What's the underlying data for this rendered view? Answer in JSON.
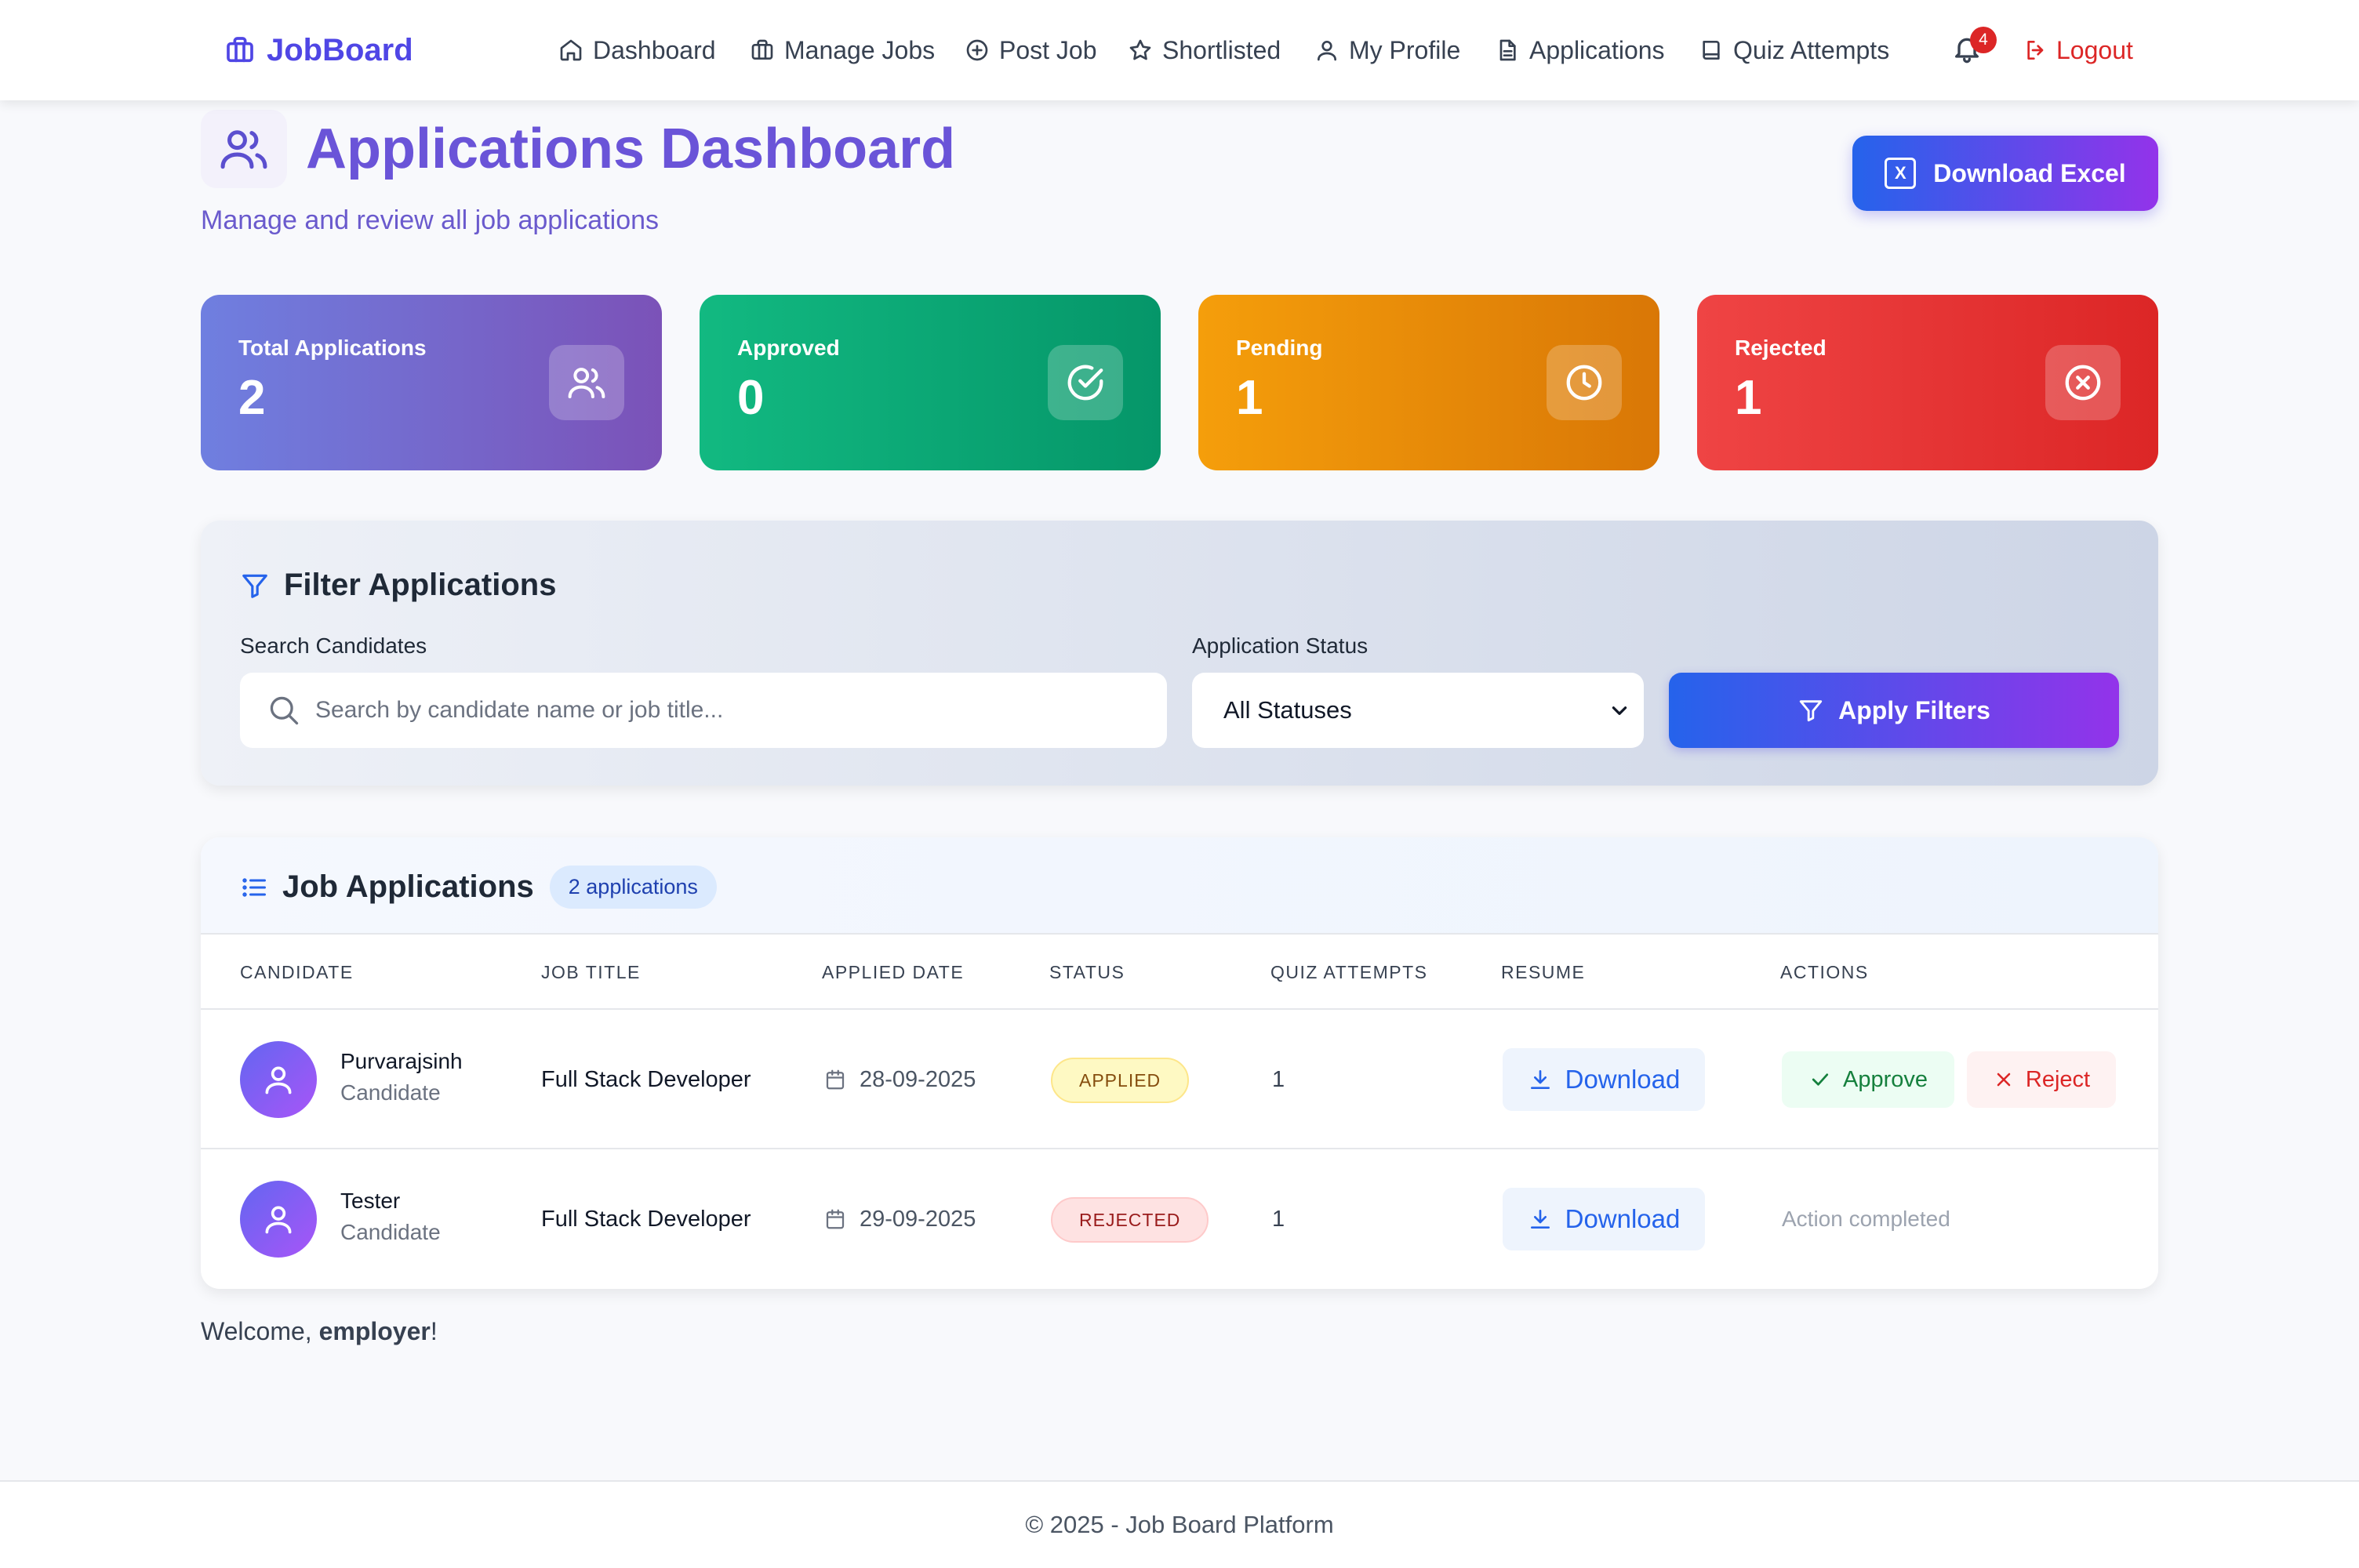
{
  "navbar": {
    "brand": "JobBoard",
    "links": [
      "Dashboard",
      "Manage Jobs",
      "Post Job",
      "Shortlisted",
      "My Profile",
      "Applications",
      "Quiz Attempts"
    ],
    "notification_count": "4",
    "logout": "Logout"
  },
  "header": {
    "title": "Applications Dashboard",
    "subtitle": "Manage and review all job applications",
    "download_excel": "Download Excel",
    "excel_icon_letter": "X"
  },
  "stats": [
    {
      "label": "Total Applications",
      "value": "2",
      "icon": "users-icon",
      "color": "#7b6fd6"
    },
    {
      "label": "Approved",
      "value": "0",
      "icon": "check-circle-icon",
      "color": "#10b981"
    },
    {
      "label": "Pending",
      "value": "1",
      "icon": "clock-icon",
      "color": "#f59e0b"
    },
    {
      "label": "Rejected",
      "value": "1",
      "icon": "x-circle-icon",
      "color": "#ef4444"
    }
  ],
  "filter": {
    "title": "Filter Applications",
    "search_label": "Search Candidates",
    "search_placeholder": "Search by candidate name or job title...",
    "status_label": "Application Status",
    "status_value": "All Statuses",
    "apply_label": "Apply Filters"
  },
  "table": {
    "title": "Job Applications",
    "count_badge": "2 applications",
    "columns": [
      "CANDIDATE",
      "JOB TITLE",
      "APPLIED DATE",
      "STATUS",
      "QUIZ ATTEMPTS",
      "RESUME",
      "ACTIONS"
    ],
    "rows": [
      {
        "name": "Purvarajsinh",
        "role": "Candidate",
        "job_title": "Full Stack Developer",
        "date": "28-09-2025",
        "status": "APPLIED",
        "quiz_attempts": "1",
        "resume": "Download",
        "approve": "Approve",
        "reject": "Reject"
      },
      {
        "name": "Tester",
        "role": "Candidate",
        "job_title": "Full Stack Developer",
        "date": "29-09-2025",
        "status": "REJECTED",
        "quiz_attempts": "1",
        "resume": "Download",
        "action_text": "Action completed"
      }
    ]
  },
  "welcome": {
    "prefix": "Welcome, ",
    "user": "employer",
    "suffix": "!"
  },
  "footer": "© 2025 - Job Board Platform"
}
